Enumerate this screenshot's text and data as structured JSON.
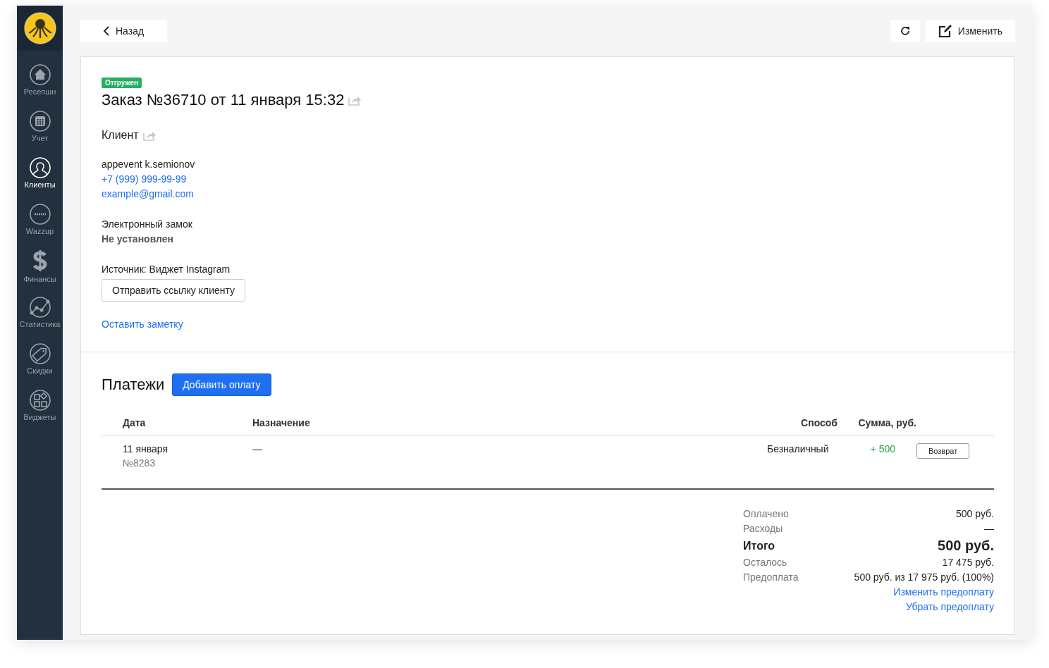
{
  "sidebar": {
    "items": [
      {
        "label": "Ресепшн",
        "kind": "home",
        "selected": false
      },
      {
        "label": "Учет",
        "kind": "calendar",
        "selected": false
      },
      {
        "label": "Клиенты",
        "kind": "person",
        "selected": true
      },
      {
        "label": "Wazzup",
        "kind": "badge",
        "selected": false
      },
      {
        "label": "Финансы",
        "kind": "dollar",
        "selected": false
      },
      {
        "label": "Статистика",
        "kind": "chart",
        "selected": false
      },
      {
        "label": "Скидки",
        "kind": "tag",
        "selected": false
      },
      {
        "label": "Виджеты",
        "kind": "widgets",
        "selected": false
      }
    ]
  },
  "toolbar": {
    "back": "Назад",
    "edit": "Изменить"
  },
  "order": {
    "status": "Отгружен",
    "title": "Заказ №36710 от 11 января 15:32",
    "client_heading": "Клиент",
    "client_name": "appevent k.semionov",
    "phone": "+7 (999) 999-99-99",
    "email": "example@gmail.com",
    "lock_label": "Электронный замок",
    "lock_value": "Не установлен",
    "source": "Источник: Виджет Instagram",
    "send_link": "Отправить ссылку клиенту",
    "note_link": "Оставить заметку"
  },
  "payments": {
    "heading": "Платежи",
    "add_button": "Добавить оплату",
    "columns": [
      "Дата",
      "Назначение",
      "Способ",
      "Сумма, руб."
    ],
    "rows": [
      {
        "date": "11 января",
        "number": "№8283",
        "purpose": "—",
        "method": "Безналичный",
        "amount": "+ 500",
        "action": "Возврат"
      }
    ]
  },
  "summary": [
    {
      "label": "Оплачено",
      "value": "500 руб.",
      "kind": "normal"
    },
    {
      "label": "Расходы",
      "value": "—",
      "kind": "normal"
    },
    {
      "label": "Итого",
      "value": "500 руб.",
      "kind": "total"
    },
    {
      "label": "Осталось",
      "value": "17 475 руб.",
      "kind": "normal"
    },
    {
      "label": "Предоплата",
      "value": "500 руб. из 17 975 руб. (100%)",
      "kind": "normal"
    }
  ],
  "summary_links": [
    "Изменить предоплату",
    "Убрать предоплату"
  ]
}
